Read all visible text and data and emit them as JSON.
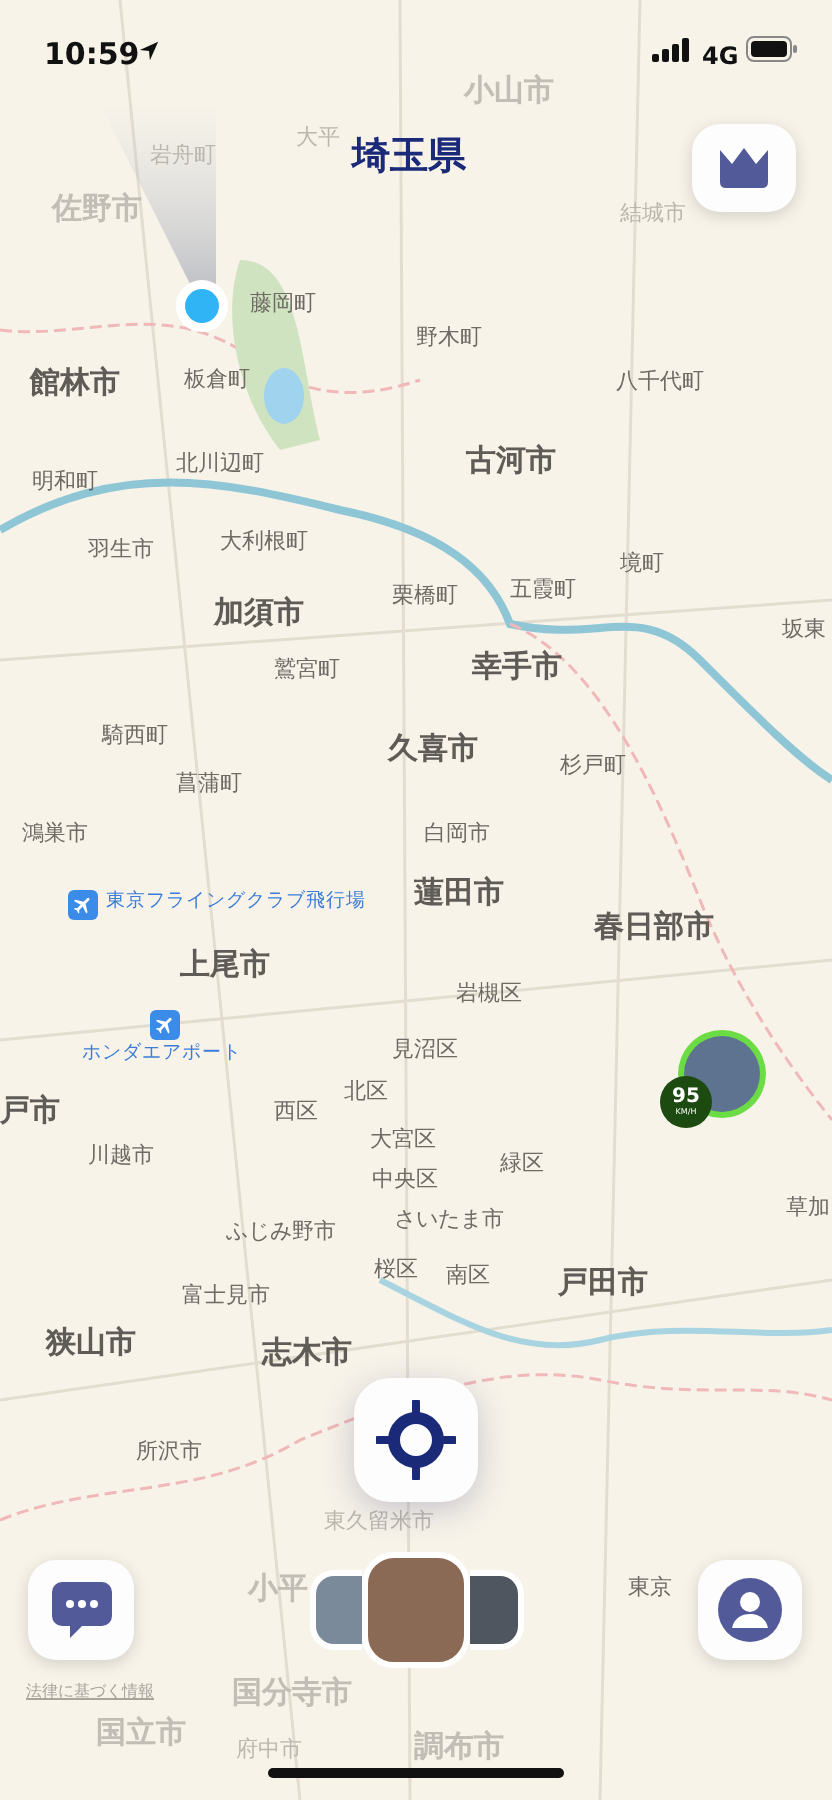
{
  "status_bar": {
    "time": "10:59",
    "network": "4G"
  },
  "map": {
    "region_title": "埼玉県",
    "labels": [
      {
        "text": "小山市",
        "kind": "major_faded"
      },
      {
        "text": "大平",
        "kind": "minor_faded"
      },
      {
        "text": "岩舟町",
        "kind": "minor_faded"
      },
      {
        "text": "佐野市",
        "kind": "major_faded"
      },
      {
        "text": "結城市",
        "kind": "minor_faded"
      },
      {
        "text": "藤岡町",
        "kind": "minor"
      },
      {
        "text": "野木町",
        "kind": "minor"
      },
      {
        "text": "館林市",
        "kind": "major"
      },
      {
        "text": "板倉町",
        "kind": "minor"
      },
      {
        "text": "八千代町",
        "kind": "minor"
      },
      {
        "text": "古河市",
        "kind": "major"
      },
      {
        "text": "北川辺町",
        "kind": "minor"
      },
      {
        "text": "明和町",
        "kind": "minor"
      },
      {
        "text": "羽生市",
        "kind": "minor"
      },
      {
        "text": "大利根町",
        "kind": "minor"
      },
      {
        "text": "境町",
        "kind": "minor"
      },
      {
        "text": "栗橋町",
        "kind": "minor"
      },
      {
        "text": "五霞町",
        "kind": "minor"
      },
      {
        "text": "坂東",
        "kind": "minor"
      },
      {
        "text": "加須市",
        "kind": "major"
      },
      {
        "text": "鷲宮町",
        "kind": "minor"
      },
      {
        "text": "幸手市",
        "kind": "major"
      },
      {
        "text": "騎西町",
        "kind": "minor"
      },
      {
        "text": "久喜市",
        "kind": "major"
      },
      {
        "text": "杉戸町",
        "kind": "minor"
      },
      {
        "text": "菖蒲町",
        "kind": "minor"
      },
      {
        "text": "鴻巣市",
        "kind": "minor"
      },
      {
        "text": "白岡市",
        "kind": "minor"
      },
      {
        "text": "東京フライングクラブ飛行場",
        "kind": "airport"
      },
      {
        "text": "蓮田市",
        "kind": "major"
      },
      {
        "text": "春日部市",
        "kind": "major"
      },
      {
        "text": "上尾市",
        "kind": "major"
      },
      {
        "text": "岩槻区",
        "kind": "minor"
      },
      {
        "text": "ホンダエアポート",
        "kind": "airport_below"
      },
      {
        "text": "見沼区",
        "kind": "minor"
      },
      {
        "text": "北区",
        "kind": "minor"
      },
      {
        "text": "西区",
        "kind": "minor"
      },
      {
        "text": "戸市",
        "kind": "major"
      },
      {
        "text": "大宮区",
        "kind": "minor"
      },
      {
        "text": "川越市",
        "kind": "minor"
      },
      {
        "text": "緑区",
        "kind": "minor"
      },
      {
        "text": "中央区",
        "kind": "minor"
      },
      {
        "text": "さいたま市",
        "kind": "minor"
      },
      {
        "text": "草加",
        "kind": "minor"
      },
      {
        "text": "ふじみ野市",
        "kind": "minor"
      },
      {
        "text": "桜区",
        "kind": "minor"
      },
      {
        "text": "南区",
        "kind": "minor"
      },
      {
        "text": "富士見市",
        "kind": "minor"
      },
      {
        "text": "戸田市",
        "kind": "major"
      },
      {
        "text": "狭山市",
        "kind": "major"
      },
      {
        "text": "志木市",
        "kind": "major"
      },
      {
        "text": "所沢市",
        "kind": "minor"
      },
      {
        "text": "東久留米市",
        "kind": "minor_faded"
      },
      {
        "text": "小平",
        "kind": "major_faded"
      },
      {
        "text": "東京",
        "kind": "minor"
      },
      {
        "text": "国分寺市",
        "kind": "major_faded"
      },
      {
        "text": "国立市",
        "kind": "major_faded"
      },
      {
        "text": "府中市",
        "kind": "minor_faded"
      },
      {
        "text": "調布市",
        "kind": "major_faded"
      }
    ]
  },
  "friend_marker": {
    "speed": "95",
    "unit": "KM/H"
  },
  "legal_link": "法律に基づく情報"
}
